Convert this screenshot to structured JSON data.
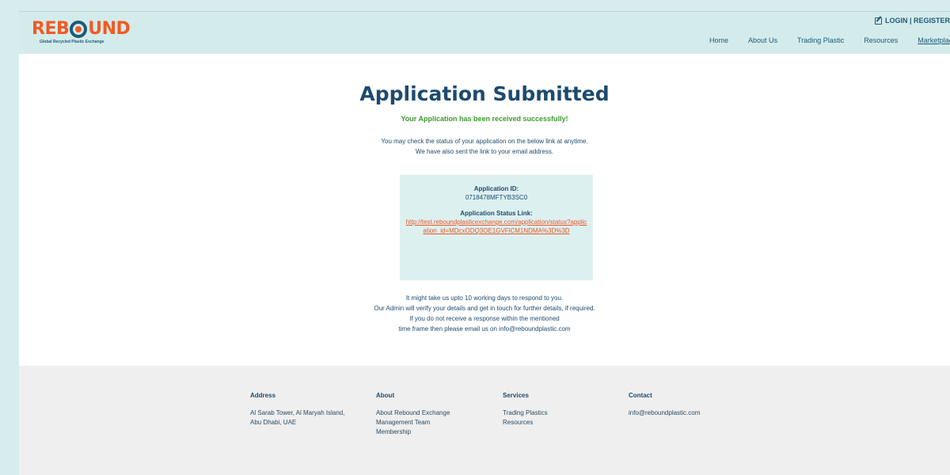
{
  "header": {
    "logo_text_left": "REB",
    "logo_text_right": "UND",
    "logo_tagline": "Global Recycled Plastic Exchange",
    "login_label": "LOGIN | REGISTER",
    "nav": [
      "Home",
      "About Us",
      "Trading Plastic",
      "Resources",
      "Marketplace"
    ]
  },
  "main": {
    "title": "Application Submitted",
    "success_message": "Your Application has been received successfully!",
    "info_line1": "You may check the status of your application on the below link at anytime.",
    "info_line2": "We have also sent the link to your email address.",
    "app_id_label": "Application ID:",
    "app_id_value": "0718478MFTYB3SC0",
    "status_link_label": "Application Status Link:",
    "status_link_url": "http://test.reboundplasticexchange.com/application/status?application_id=MDcxODQ3OE1GVFlCM1NDMA%3D%3D",
    "follow_line1": "It might take us upto 10 working days to respond to you.",
    "follow_line2": "Our Admin will verify your details and get in touch for further details, if required.",
    "follow_line3": "If you do not receive a response within the mentioned",
    "follow_line4": "time frame then please email us on info@reboundplastic.com"
  },
  "footer": {
    "address": {
      "heading": "Address",
      "lines": [
        "Al Sarab Tower, Al Maryah Island,",
        "Abu Dhabi, UAE"
      ]
    },
    "about": {
      "heading": "About",
      "lines": [
        "About Rebound Exchange",
        "Management Team",
        "Membership"
      ]
    },
    "services": {
      "heading": "Services",
      "lines": [
        "Trading Plastics",
        "Resources"
      ]
    },
    "contact": {
      "heading": "Contact",
      "lines": [
        "info@reboundplastic.com"
      ]
    }
  },
  "colors": {
    "brand_orange": "#f05a23",
    "brand_navy": "#1e4a6e",
    "success_green": "#3d9a2e",
    "header_bg": "#d4ebeb"
  }
}
